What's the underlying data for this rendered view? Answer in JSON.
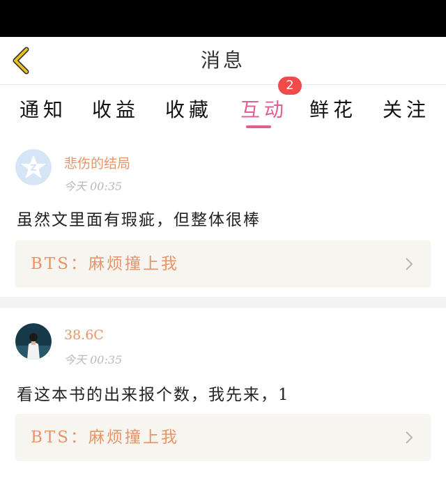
{
  "header": {
    "title": "消息",
    "back_icon": "chevron-left-icon",
    "back_color": "#e8c21a"
  },
  "tabs": [
    {
      "label": "通知"
    },
    {
      "label": "收益"
    },
    {
      "label": "收藏"
    },
    {
      "label": "互动",
      "active": true,
      "badge": "2"
    },
    {
      "label": "鲜花"
    },
    {
      "label": "关注"
    }
  ],
  "accent": "#e0608f",
  "messages": [
    {
      "name": "悲伤的结局",
      "time": "今天 00:35",
      "content": "虽然文里面有瑕疵，但整体很棒",
      "reference": "BTS：麻烦撞上我",
      "avatar": "qq-default-avatar"
    },
    {
      "name": "38.6C",
      "time": "今天 00:35",
      "content": "看这本书的出来报个数，我先来，1",
      "reference": "BTS：麻烦撞上我",
      "avatar": "user-photo-avatar"
    }
  ]
}
